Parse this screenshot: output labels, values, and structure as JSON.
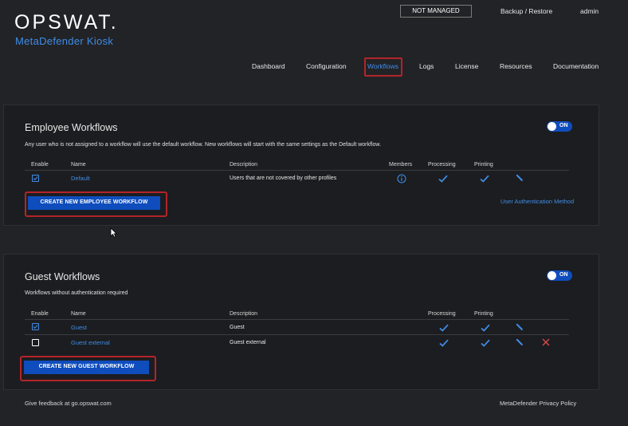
{
  "header": {
    "brand": "OPSWAT.",
    "product": "MetaDefender Kiosk",
    "status_badge": "NOT MANAGED",
    "backup_link": "Backup / Restore",
    "user": "admin"
  },
  "nav": {
    "items": [
      "Dashboard",
      "Configuration",
      "Workflows",
      "Logs",
      "License",
      "Resources",
      "Documentation"
    ],
    "active": "Workflows"
  },
  "employee": {
    "title": "Employee Workflows",
    "toggle": "ON",
    "description": "Any user who is not assigned to a workflow will use the default workflow. New workflows will start with the same settings as the Default workflow.",
    "columns": {
      "enable": "Enable",
      "name": "Name",
      "description": "Description",
      "members": "Members",
      "processing": "Processing",
      "printing": "Printing"
    },
    "rows": [
      {
        "enabled": true,
        "name": "Default",
        "description": "Users that are not covered by other profiles"
      }
    ],
    "create_button": "CREATE NEW EMPLOYEE WORKFLOW",
    "auth_link": "User Authentication Method"
  },
  "guest": {
    "title": "Guest Workflows",
    "toggle": "ON",
    "description": "Workflows without authentication required",
    "columns": {
      "enable": "Enable",
      "name": "Name",
      "description": "Description",
      "processing": "Processing",
      "printing": "Printing"
    },
    "rows": [
      {
        "enabled": true,
        "name": "Guest",
        "description": "Guest"
      },
      {
        "enabled": false,
        "name": "Guest external",
        "description": "Guest external"
      }
    ],
    "create_button": "CREATE NEW GUEST WORKFLOW"
  },
  "footer": {
    "feedback": "Give feedback at go.opswat.com",
    "privacy": "MetaDefender Privacy Policy"
  },
  "colors": {
    "accent": "#3f8ce6",
    "button": "#0f4dbd",
    "highlight": "#b3242a",
    "delete": "#d94a4a"
  }
}
